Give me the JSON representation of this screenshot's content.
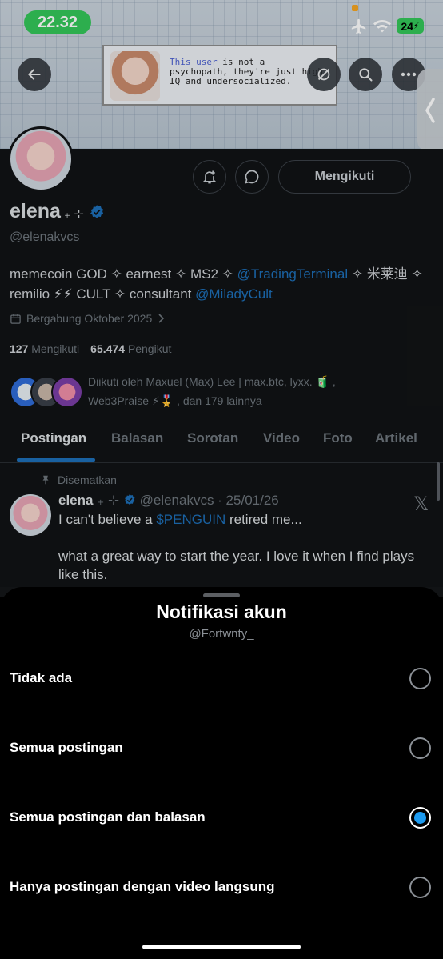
{
  "status_bar": {
    "time": "22.32",
    "battery": "24"
  },
  "banner": {
    "note_text_hl": "This user",
    "note_text": " is not a psychopath, they're just high IQ and undersocialized."
  },
  "profile": {
    "name": "elena",
    "name_deco": " ₊ ⊹",
    "handle": "@elenakvcs",
    "follow_button": "Mengikuti",
    "bio_parts": {
      "p1": "memecoin GOD ✧ earnest ✧ MS2 ✧ ",
      "link1": "@TradingTerminal",
      "p2": " ✧ 米莱迪 ✧ remilio ⚡⚡ CULT ✧ consultant ",
      "link2": "@MiladyCult"
    },
    "joined": "Bergabung Oktober 2025",
    "following_count": "127",
    "following_label": "Mengikuti",
    "followers_count": "65.474",
    "followers_label": "Pengikut",
    "followed_by": "Diikuti oleh Maxuel (Max) Lee | max.btc, lyxx. 🧃 , Web3Praise ⚡🎖️ , dan 179 lainnya"
  },
  "tabs": [
    "Postingan",
    "Balasan",
    "Sorotan",
    "Video",
    "Foto",
    "Artikel"
  ],
  "pinned_post": {
    "pinned_label": "Disematkan",
    "author": "elena",
    "author_deco": " ₊ ⊹ ",
    "meta": " @elenakvcs · 25/01/26",
    "line1_pre": "I can't believe a ",
    "cashtag": "$PENGUIN",
    "line1_post": " retired me...",
    "body": "what a great way to start the year. I love it when I find plays like this."
  },
  "sheet": {
    "title": "Notifikasi akun",
    "subtitle": "@Fortwnty_",
    "options": [
      {
        "label": "Tidak ada",
        "selected": false
      },
      {
        "label": "Semua postingan",
        "selected": false
      },
      {
        "label": "Semua postingan dan balasan",
        "selected": true
      },
      {
        "label": "Hanya postingan dengan video langsung",
        "selected": false
      }
    ]
  },
  "colors": {
    "accent": "#1d9bf0",
    "link": "#1d6fb8",
    "status_green": "#34c759"
  }
}
